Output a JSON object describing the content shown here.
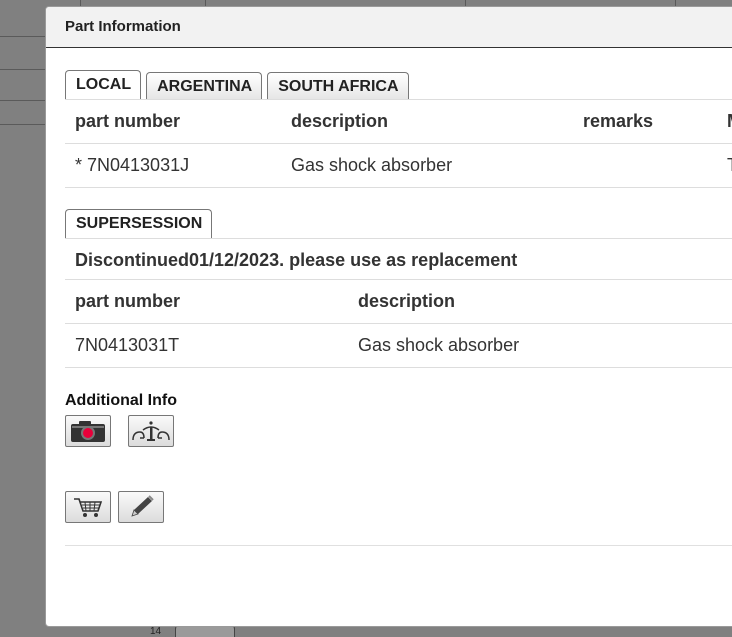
{
  "dialog": {
    "title": "Part Information"
  },
  "region_tabs": [
    {
      "label": "LOCAL",
      "active": true
    },
    {
      "label": "ARGENTINA",
      "active": false
    },
    {
      "label": "SOUTH AFRICA",
      "active": false
    }
  ],
  "parts_table": {
    "headers": [
      "part number",
      "description",
      "remarks",
      "M"
    ],
    "rows": [
      {
        "part_number": "* 7N0413031J",
        "description": "Gas shock absorber",
        "remarks": "",
        "extra": "T"
      }
    ]
  },
  "supersession": {
    "tab_label": "SUPERSESSION",
    "notice": "Discontinued01/12/2023. please use as replacement",
    "headers": [
      "part number",
      "description"
    ],
    "rows": [
      {
        "part_number": "7N0413031T",
        "description": "Gas shock absorber"
      }
    ]
  },
  "additional_info": {
    "title": "Additional Info",
    "icons": [
      "camera-icon",
      "info-diagram-icon"
    ]
  },
  "actions": {
    "icons": [
      "shopping-cart-icon",
      "pencil-icon"
    ]
  },
  "background": {
    "figure_label": "14"
  }
}
